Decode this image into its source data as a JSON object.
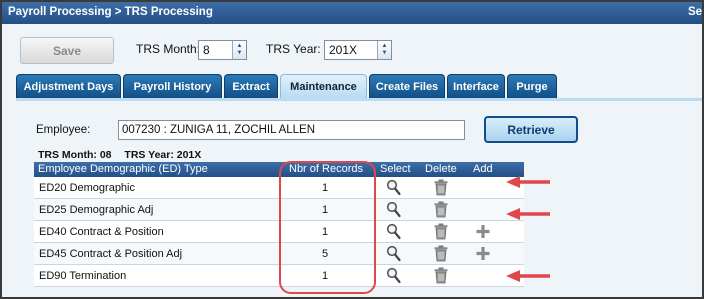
{
  "header": {
    "breadcrumb": "Payroll Processing > TRS Processing",
    "right_text": "Se"
  },
  "toolbar": {
    "save_label": "Save",
    "trs_month_label": "TRS Month:",
    "trs_month_value": "8",
    "trs_year_label": "TRS Year:",
    "trs_year_value": "201X"
  },
  "tabs": [
    {
      "label": "Adjustment Days"
    },
    {
      "label": "Payroll History"
    },
    {
      "label": "Extract"
    },
    {
      "label": "Maintenance"
    },
    {
      "label": "Create Files"
    },
    {
      "label": "Interface"
    },
    {
      "label": "Purge"
    }
  ],
  "form": {
    "employee_label": "Employee:",
    "employee_value": "007230 : ZUNIGA 11, ZOCHIL ALLEN",
    "retrieve_label": "Retrieve",
    "trs_month_info": "TRS Month:  08",
    "trs_year_info": "TRS Year:  201X"
  },
  "table": {
    "columns": [
      "Employee Demographic (ED) Type",
      "Nbr of Records",
      "Select",
      "Delete",
      "Add"
    ],
    "rows": [
      {
        "type": "ED20 Demographic",
        "records": "1",
        "add": false
      },
      {
        "type": "ED25 Demographic Adj",
        "records": "1",
        "add": false
      },
      {
        "type": "ED40 Contract & Position",
        "records": "1",
        "add": true
      },
      {
        "type": "ED45 Contract & Position Adj",
        "records": "5",
        "add": true
      },
      {
        "type": "ED90 Termination",
        "records": "1",
        "add": false
      }
    ]
  },
  "colors": {
    "header_blue": "#234f86",
    "tab_active": "#b9dbf3",
    "annotation_red": "#e0474c"
  },
  "icons": [
    "magnifier-icon",
    "trash-icon",
    "plus-icon",
    "spinner-arrows-icon",
    "red-arrow-icon"
  ]
}
